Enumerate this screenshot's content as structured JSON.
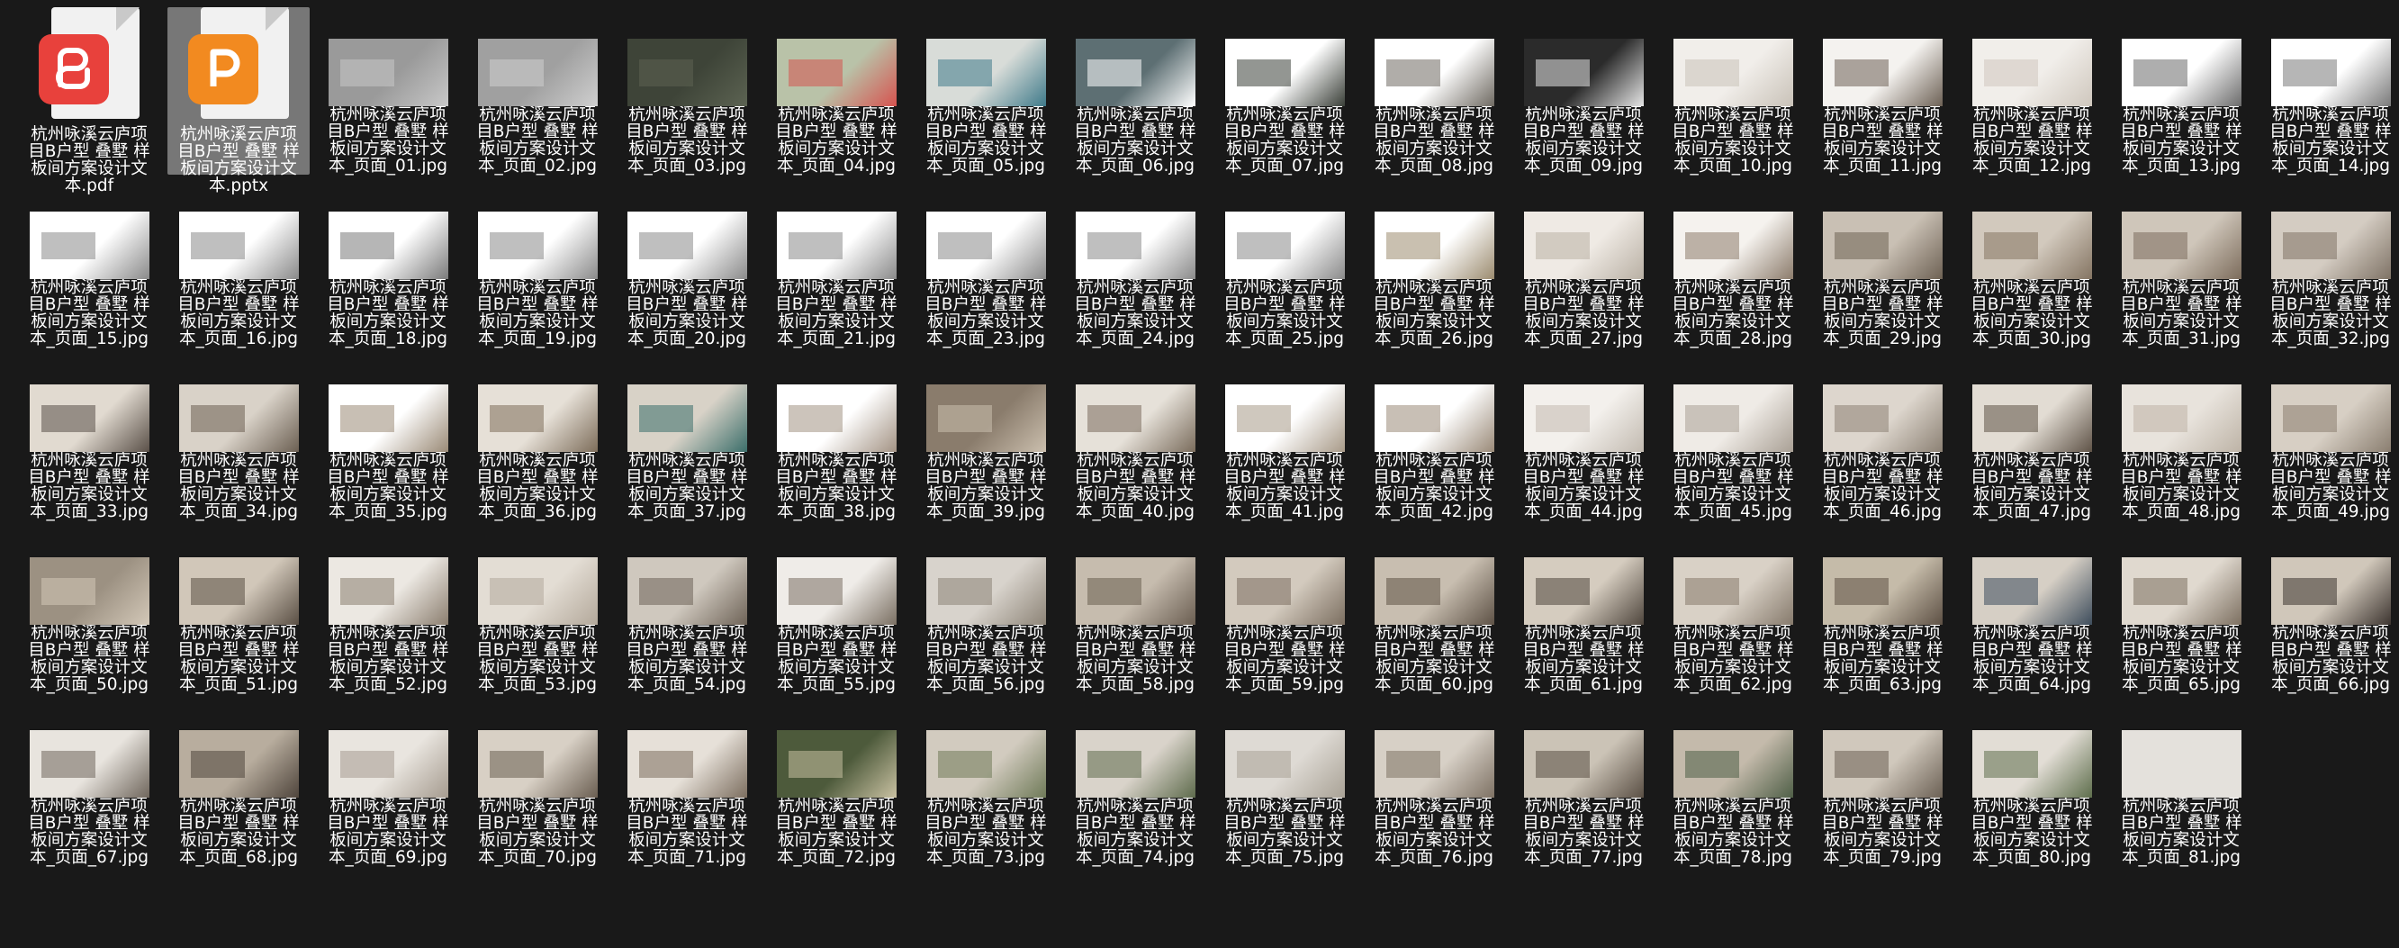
{
  "files": [
    {
      "name_lines": [
        "杭州咏溪云庐项",
        "目B户型 叠墅 样",
        "板间方案设计文",
        "本.pdf"
      ],
      "kind": "pdf",
      "selected": false
    },
    {
      "name_lines": [
        "杭州咏溪云庐项",
        "目B户型 叠墅 样",
        "板间方案设计文",
        "本.pptx"
      ],
      "kind": "pptx",
      "selected": true
    },
    {
      "name_lines": [
        "杭州咏溪云庐项",
        "目B户型 叠墅 样",
        "板间方案设计文",
        "本_页面_01.jpg"
      ],
      "kind": "jpg",
      "tone": "#9a9a9a",
      "accent": "#c8c8c8"
    },
    {
      "name_lines": [
        "杭州咏溪云庐项",
        "目B户型 叠墅 样",
        "板间方案设计文",
        "本_页面_02.jpg"
      ],
      "kind": "jpg",
      "tone": "#a0a0a0",
      "accent": "#cfcfcf"
    },
    {
      "name_lines": [
        "杭州咏溪云庐项",
        "目B户型 叠墅 样",
        "板间方案设计文",
        "本_页面_03.jpg"
      ],
      "kind": "jpg",
      "tone": "#3e4438",
      "accent": "#5c6352"
    },
    {
      "name_lines": [
        "杭州咏溪云庐项",
        "目B户型 叠墅 样",
        "板间方案设计文",
        "本_页面_04.jpg"
      ],
      "kind": "jpg",
      "tone": "#b9c2a8",
      "accent": "#d6534f"
    },
    {
      "name_lines": [
        "杭州咏溪云庐项",
        "目B户型 叠墅 样",
        "板间方案设计文",
        "本_页面_05.jpg"
      ],
      "kind": "jpg",
      "tone": "#d8dcd8",
      "accent": "#3f7a8a"
    },
    {
      "name_lines": [
        "杭州咏溪云庐项",
        "目B户型 叠墅 样",
        "板间方案设计文",
        "本_页面_06.jpg"
      ],
      "kind": "jpg",
      "tone": "#5d6f73",
      "accent": "#ffffff"
    },
    {
      "name_lines": [
        "杭州咏溪云庐项",
        "目B户型 叠墅 样",
        "板间方案设计文",
        "本_页面_07.jpg"
      ],
      "kind": "jpg",
      "tone": "#ffffff",
      "accent": "#3a3f38"
    },
    {
      "name_lines": [
        "杭州咏溪云庐项",
        "目B户型 叠墅 样",
        "板间方案设计文",
        "本_页面_08.jpg"
      ],
      "kind": "jpg",
      "tone": "#ffffff",
      "accent": "#6f6a62"
    },
    {
      "name_lines": [
        "杭州咏溪云庐项",
        "目B户型 叠墅 样",
        "板间方案设计文",
        "本_页面_09.jpg"
      ],
      "kind": "jpg",
      "tone": "#2b2b2b",
      "accent": "#e6e6e6"
    },
    {
      "name_lines": [
        "杭州咏溪云庐项",
        "目B户型 叠墅 样",
        "板间方案设计文",
        "本_页面_10.jpg"
      ],
      "kind": "jpg",
      "tone": "#f1eeea",
      "accent": "#c9c2b8"
    },
    {
      "name_lines": [
        "杭州咏溪云庐项",
        "目B户型 叠墅 样",
        "板间方案设计文",
        "本_页面_11.jpg"
      ],
      "kind": "jpg",
      "tone": "#f4f2ef",
      "accent": "#6d6155"
    },
    {
      "name_lines": [
        "杭州咏溪云庐项",
        "目B户型 叠墅 样",
        "板间方案设计文",
        "本_页面_12.jpg"
      ],
      "kind": "jpg",
      "tone": "#f1eeea",
      "accent": "#cfc7bd"
    },
    {
      "name_lines": [
        "杭州咏溪云庐项",
        "目B户型 叠墅 样",
        "板间方案设计文",
        "本_页面_13.jpg"
      ],
      "kind": "jpg",
      "tone": "#ffffff",
      "accent": "#6b6b6b"
    },
    {
      "name_lines": [
        "杭州咏溪云庐项",
        "目B户型 叠墅 样",
        "板间方案设计文",
        "本_页面_14.jpg"
      ],
      "kind": "jpg",
      "tone": "#ffffff",
      "accent": "#7a7a7a"
    },
    {
      "name_lines": [
        "杭州咏溪云庐项",
        "目B户型 叠墅 样",
        "板间方案设计文",
        "本_页面_15.jpg"
      ],
      "kind": "jpg",
      "tone": "#ffffff",
      "accent": "#8a8a8a"
    },
    {
      "name_lines": [
        "杭州咏溪云庐项",
        "目B户型 叠墅 样",
        "板间方案设计文",
        "本_页面_16.jpg"
      ],
      "kind": "jpg",
      "tone": "#ffffff",
      "accent": "#8a8a8a"
    },
    {
      "name_lines": [
        "杭州咏溪云庐项",
        "目B户型 叠墅 样",
        "板间方案设计文",
        "本_页面_18.jpg"
      ],
      "kind": "jpg",
      "tone": "#ffffff",
      "accent": "#7a7a7a"
    },
    {
      "name_lines": [
        "杭州咏溪云庐项",
        "目B户型 叠墅 样",
        "板间方案设计文",
        "本_页面_19.jpg"
      ],
      "kind": "jpg",
      "tone": "#ffffff",
      "accent": "#8a8a8a"
    },
    {
      "name_lines": [
        "杭州咏溪云庐项",
        "目B户型 叠墅 样",
        "板间方案设计文",
        "本_页面_20.jpg"
      ],
      "kind": "jpg",
      "tone": "#ffffff",
      "accent": "#8a8a8a"
    },
    {
      "name_lines": [
        "杭州咏溪云庐项",
        "目B户型 叠墅 样",
        "板间方案设计文",
        "本_页面_21.jpg"
      ],
      "kind": "jpg",
      "tone": "#ffffff",
      "accent": "#8a8a8a"
    },
    {
      "name_lines": [
        "杭州咏溪云庐项",
        "目B户型 叠墅 样",
        "板间方案设计文",
        "本_页面_23.jpg"
      ],
      "kind": "jpg",
      "tone": "#ffffff",
      "accent": "#8a8a8a"
    },
    {
      "name_lines": [
        "杭州咏溪云庐项",
        "目B户型 叠墅 样",
        "板间方案设计文",
        "本_页面_24.jpg"
      ],
      "kind": "jpg",
      "tone": "#ffffff",
      "accent": "#8a8a8a"
    },
    {
      "name_lines": [
        "杭州咏溪云庐项",
        "目B户型 叠墅 样",
        "板间方案设计文",
        "本_页面_25.jpg"
      ],
      "kind": "jpg",
      "tone": "#ffffff",
      "accent": "#8a8a8a"
    },
    {
      "name_lines": [
        "杭州咏溪云庐项",
        "目B户型 叠墅 样",
        "板间方案设计文",
        "本_页面_26.jpg"
      ],
      "kind": "jpg",
      "tone": "#ffffff",
      "accent": "#9c8c70"
    },
    {
      "name_lines": [
        "杭州咏溪云庐项",
        "目B户型 叠墅 样",
        "板间方案设计文",
        "本_页面_27.jpg"
      ],
      "kind": "jpg",
      "tone": "#efeae4",
      "accent": "#b9b0a4"
    },
    {
      "name_lines": [
        "杭州咏溪云庐项",
        "目B户型 叠墅 样",
        "板间方案设计文",
        "本_页面_28.jpg"
      ],
      "kind": "jpg",
      "tone": "#f5f2ee",
      "accent": "#8c7c6c"
    },
    {
      "name_lines": [
        "杭州咏溪云庐项",
        "目B户型 叠墅 样",
        "板间方案设计文",
        "本_页面_29.jpg"
      ],
      "kind": "jpg",
      "tone": "#c9c0b4",
      "accent": "#6e6254"
    },
    {
      "name_lines": [
        "杭州咏溪云庐项",
        "目B户型 叠墅 样",
        "板间方案设计文",
        "本_页面_30.jpg"
      ],
      "kind": "jpg",
      "tone": "#d2c9bd",
      "accent": "#857563"
    },
    {
      "name_lines": [
        "杭州咏溪云庐项",
        "目B户型 叠墅 样",
        "板间方案设计文",
        "本_页面_31.jpg"
      ],
      "kind": "jpg",
      "tone": "#cfc6ba",
      "accent": "#7c6c5c"
    },
    {
      "name_lines": [
        "杭州咏溪云庐项",
        "目B户型 叠墅 样",
        "板间方案设计文",
        "本_页面_32.jpg"
      ],
      "kind": "jpg",
      "tone": "#d4ccc2",
      "accent": "#7f7366"
    },
    {
      "name_lines": [
        "杭州咏溪云庐项",
        "目B户型 叠墅 样",
        "板间方案设计文",
        "本_页面_33.jpg"
      ],
      "kind": "jpg",
      "tone": "#e1dad0",
      "accent": "#5a5048"
    },
    {
      "name_lines": [
        "杭州咏溪云庐项",
        "目B户型 叠墅 样",
        "板间方案设计文",
        "本_页面_34.jpg"
      ],
      "kind": "jpg",
      "tone": "#d9d2c8",
      "accent": "#6b5f52"
    },
    {
      "name_lines": [
        "杭州咏溪云庐项",
        "目B户型 叠墅 样",
        "板间方案设计文",
        "本_页面_35.jpg"
      ],
      "kind": "jpg",
      "tone": "#ffffff",
      "accent": "#9a8a76"
    },
    {
      "name_lines": [
        "杭州咏溪云庐项",
        "目B户型 叠墅 样",
        "板间方案设计文",
        "本_页面_36.jpg"
      ],
      "kind": "jpg",
      "tone": "#e6e0d7",
      "accent": "#7d6d5a"
    },
    {
      "name_lines": [
        "杭州咏溪云庐项",
        "目B户型 叠墅 样",
        "板间方案设计文",
        "本_页面_37.jpg"
      ],
      "kind": "jpg",
      "tone": "#d8d2c7",
      "accent": "#3b6e6a"
    },
    {
      "name_lines": [
        "杭州咏溪云庐项",
        "目B户型 叠墅 样",
        "板间方案设计文",
        "本_页面_38.jpg"
      ],
      "kind": "jpg",
      "tone": "#ffffff",
      "accent": "#a39384"
    },
    {
      "name_lines": [
        "杭州咏溪云庐项",
        "目B户型 叠墅 样",
        "板间方案设计文",
        "本_页面_39.jpg"
      ],
      "kind": "jpg",
      "tone": "#8a7c6c",
      "accent": "#cbbfae"
    },
    {
      "name_lines": [
        "杭州咏溪云庐项",
        "目B户型 叠墅 样",
        "板间方案设计文",
        "本_页面_40.jpg"
      ],
      "kind": "jpg",
      "tone": "#e6e1d9",
      "accent": "#7a6c5c"
    },
    {
      "name_lines": [
        "杭州咏溪云庐项",
        "目B户型 叠墅 样",
        "板间方案设计文",
        "本_页面_41.jpg"
      ],
      "kind": "jpg",
      "tone": "#ffffff",
      "accent": "#a89a88"
    },
    {
      "name_lines": [
        "杭州咏溪云庐项",
        "目B户型 叠墅 样",
        "板间方案设计文",
        "本_页面_42.jpg"
      ],
      "kind": "jpg",
      "tone": "#ffffff",
      "accent": "#9a8a78"
    },
    {
      "name_lines": [
        "杭州咏溪云庐项",
        "目B户型 叠墅 样",
        "板间方案设计文",
        "本_页面_44.jpg"
      ],
      "kind": "jpg",
      "tone": "#f3f0ec",
      "accent": "#c2bab0"
    },
    {
      "name_lines": [
        "杭州咏溪云庐项",
        "目B户型 叠墅 样",
        "板间方案设计文",
        "本_页面_45.jpg"
      ],
      "kind": "jpg",
      "tone": "#efebe6",
      "accent": "#a9a095"
    },
    {
      "name_lines": [
        "杭州咏溪云庐项",
        "目B户型 叠墅 样",
        "板间方案设计文",
        "本_页面_46.jpg"
      ],
      "kind": "jpg",
      "tone": "#ddd6cd",
      "accent": "#8c8174"
    },
    {
      "name_lines": [
        "杭州咏溪云庐项",
        "目B户型 叠墅 样",
        "板间方案设计文",
        "本_页面_47.jpg"
      ],
      "kind": "jpg",
      "tone": "#e2dcd3",
      "accent": "#5f5347"
    },
    {
      "name_lines": [
        "杭州咏溪云庐项",
        "目B户型 叠墅 样",
        "板间方案设计文",
        "本_页面_48.jpg"
      ],
      "kind": "jpg",
      "tone": "#e8e3dc",
      "accent": "#bdb3a6"
    },
    {
      "name_lines": [
        "杭州咏溪云庐项",
        "目B户型 叠墅 样",
        "板间方案设计文",
        "本_页面_49.jpg"
      ],
      "kind": "jpg",
      "tone": "#d7cfc4",
      "accent": "#8a7e70"
    },
    {
      "name_lines": [
        "杭州咏溪云庐项",
        "目B户型 叠墅 样",
        "板间方案设计文",
        "本_页面_50.jpg"
      ],
      "kind": "jpg",
      "tone": "#9c9182",
      "accent": "#d3c8b8"
    },
    {
      "name_lines": [
        "杭州咏溪云庐项",
        "目B户型 叠墅 样",
        "板间方案设计文",
        "本_页面_51.jpg"
      ],
      "kind": "jpg",
      "tone": "#d1c7b9",
      "accent": "#5a4f44"
    },
    {
      "name_lines": [
        "杭州咏溪云庐项",
        "目B户型 叠墅 样",
        "板间方案设计文",
        "本_页面_52.jpg"
      ],
      "kind": "jpg",
      "tone": "#ece8e2",
      "accent": "#8b7e6f"
    },
    {
      "name_lines": [
        "杭州咏溪云庐项",
        "目B户型 叠墅 样",
        "板间方案设计文",
        "本_页面_53.jpg"
      ],
      "kind": "jpg",
      "tone": "#e3ddd4",
      "accent": "#b3a89a"
    },
    {
      "name_lines": [
        "杭州咏溪云庐项",
        "目B户型 叠墅 样",
        "板间方案设计文",
        "本_页面_54.jpg"
      ],
      "kind": "jpg",
      "tone": "#cfc8be",
      "accent": "#6e6357"
    },
    {
      "name_lines": [
        "杭州咏溪云庐项",
        "目B户型 叠墅 样",
        "板间方案设计文",
        "本_页面_55.jpg"
      ],
      "kind": "jpg",
      "tone": "#efece8",
      "accent": "#7a6f62"
    },
    {
      "name_lines": [
        "杭州咏溪云庐项",
        "目B户型 叠墅 样",
        "板间方案设计文",
        "本_页面_56.jpg"
      ],
      "kind": "jpg",
      "tone": "#d8d3cc",
      "accent": "#8d8477"
    },
    {
      "name_lines": [
        "杭州咏溪云庐项",
        "目B户型 叠墅 样",
        "板间方案设计文",
        "本_页面_58.jpg"
      ],
      "kind": "jpg",
      "tone": "#c6bcae",
      "accent": "#6a5e51"
    },
    {
      "name_lines": [
        "杭州咏溪云庐项",
        "目B户型 叠墅 样",
        "板间方案设计文",
        "本_页面_59.jpg"
      ],
      "kind": "jpg",
      "tone": "#d3cabe",
      "accent": "#7b6e60"
    },
    {
      "name_lines": [
        "杭州咏溪云庐项",
        "目B户型 叠墅 样",
        "板间方案设计文",
        "本_页面_60.jpg"
      ],
      "kind": "jpg",
      "tone": "#c8beb0",
      "accent": "#5e5246"
    },
    {
      "name_lines": [
        "杭州咏溪云庐项",
        "目B户型 叠墅 样",
        "板间方案设计文",
        "本_页面_61.jpg"
      ],
      "kind": "jpg",
      "tone": "#d5ccbf",
      "accent": "#4f463d"
    },
    {
      "name_lines": [
        "杭州咏溪云庐项",
        "目B户型 叠墅 样",
        "板间方案设计文",
        "本_页面_62.jpg"
      ],
      "kind": "jpg",
      "tone": "#d9d1c6",
      "accent": "#867a6c"
    },
    {
      "name_lines": [
        "杭州咏溪云庐项",
        "目B户型 叠墅 样",
        "板间方案设计文",
        "本_页面_63.jpg"
      ],
      "kind": "jpg",
      "tone": "#c5bba9",
      "accent": "#5d5044"
    },
    {
      "name_lines": [
        "杭州咏溪云庐项",
        "目B户型 叠墅 样",
        "板间方案设计文",
        "本_页面_64.jpg"
      ],
      "kind": "jpg",
      "tone": "#d6cfc5",
      "accent": "#3e4d5c"
    },
    {
      "name_lines": [
        "杭州咏溪云庐项",
        "目B户型 叠墅 样",
        "板间方案设计文",
        "本_页面_65.jpg"
      ],
      "kind": "jpg",
      "tone": "#e0d9cf",
      "accent": "#7c6f60"
    },
    {
      "name_lines": [
        "杭州咏溪云庐项",
        "目B户型 叠墅 样",
        "板间方案设计文",
        "本_页面_66.jpg"
      ],
      "kind": "jpg",
      "tone": "#d0c7ba",
      "accent": "#3d3530"
    },
    {
      "name_lines": [
        "杭州咏溪云庐项",
        "目B户型 叠墅 样",
        "板间方案设计文",
        "本_页面_67.jpg"
      ],
      "kind": "jpg",
      "tone": "#e8e4de",
      "accent": "#6f665c"
    },
    {
      "name_lines": [
        "杭州咏溪云庐项",
        "目B户型 叠墅 样",
        "板间方案设计文",
        "本_页面_68.jpg"
      ],
      "kind": "jpg",
      "tone": "#b8ad9e",
      "accent": "#4f453c"
    },
    {
      "name_lines": [
        "杭州咏溪云庐项",
        "目B户型 叠墅 样",
        "板间方案设计文",
        "本_页面_69.jpg"
      ],
      "kind": "jpg",
      "tone": "#e9e5df",
      "accent": "#a59b8f"
    },
    {
      "name_lines": [
        "杭州咏溪云庐项",
        "目B户型 叠墅 样",
        "板间方案设计文",
        "本_页面_70.jpg"
      ],
      "kind": "jpg",
      "tone": "#d8d0c5",
      "accent": "#6a5e51"
    },
    {
      "name_lines": [
        "杭州咏溪云庐项",
        "目B户型 叠墅 样",
        "板间方案设计文",
        "本_页面_71.jpg"
      ],
      "kind": "jpg",
      "tone": "#e6e0d8",
      "accent": "#7c6e5f"
    },
    {
      "name_lines": [
        "杭州咏溪云庐项",
        "目B户型 叠墅 样",
        "板间方案设计文",
        "本_页面_72.jpg"
      ],
      "kind": "jpg",
      "tone": "#4d5a3b",
      "accent": "#c9c1a2"
    },
    {
      "name_lines": [
        "杭州咏溪云庐项",
        "目B户型 叠墅 样",
        "板间方案设计文",
        "本_页面_73.jpg"
      ],
      "kind": "jpg",
      "tone": "#d2cbbf",
      "accent": "#6f7a58"
    },
    {
      "name_lines": [
        "杭州咏溪云庐项",
        "目B户型 叠墅 样",
        "板间方案设计文",
        "本_页面_74.jpg"
      ],
      "kind": "jpg",
      "tone": "#d9d3ca",
      "accent": "#5e6b4c"
    },
    {
      "name_lines": [
        "杭州咏溪云庐项",
        "目B户型 叠墅 样",
        "板间方案设计文",
        "本_页面_75.jpg"
      ],
      "kind": "jpg",
      "tone": "#dedad4",
      "accent": "#a9a296"
    },
    {
      "name_lines": [
        "杭州咏溪云庐项",
        "目B户型 叠墅 样",
        "板间方案设计文",
        "本_页面_76.jpg"
      ],
      "kind": "jpg",
      "tone": "#d7d0c6",
      "accent": "#7e7264"
    },
    {
      "name_lines": [
        "杭州咏溪云庐项",
        "目B户型 叠墅 样",
        "板间方案设计文",
        "本_页面_77.jpg"
      ],
      "kind": "jpg",
      "tone": "#cbc3b6",
      "accent": "#5a4f44"
    },
    {
      "name_lines": [
        "杭州咏溪云庐项",
        "目B户型 叠墅 样",
        "板间方案设计文",
        "本_页面_78.jpg"
      ],
      "kind": "jpg",
      "tone": "#c4baab",
      "accent": "#4f5f47"
    },
    {
      "name_lines": [
        "杭州咏溪云庐项",
        "目B户型 叠墅 样",
        "板间方案设计文",
        "本_页面_79.jpg"
      ],
      "kind": "jpg",
      "tone": "#d0c8bc",
      "accent": "#6b6054"
    },
    {
      "name_lines": [
        "杭州咏溪云庐项",
        "目B户型 叠墅 样",
        "板间方案设计文",
        "本_页面_80.jpg"
      ],
      "kind": "jpg",
      "tone": "#e2ddd5",
      "accent": "#5e6e4c"
    },
    {
      "name_lines": [
        "杭州咏溪云庐项",
        "目B户型 叠墅 样",
        "板间方案设计文",
        "本_页面_81.jpg"
      ],
      "kind": "jpg",
      "tone": "#e4e1dc",
      "accent": "#e4e1dc"
    }
  ],
  "colors": {
    "background": "#191919",
    "selection": "#777777",
    "pdf_badge": "#e8413c",
    "pptx_badge": "#f28a20"
  }
}
